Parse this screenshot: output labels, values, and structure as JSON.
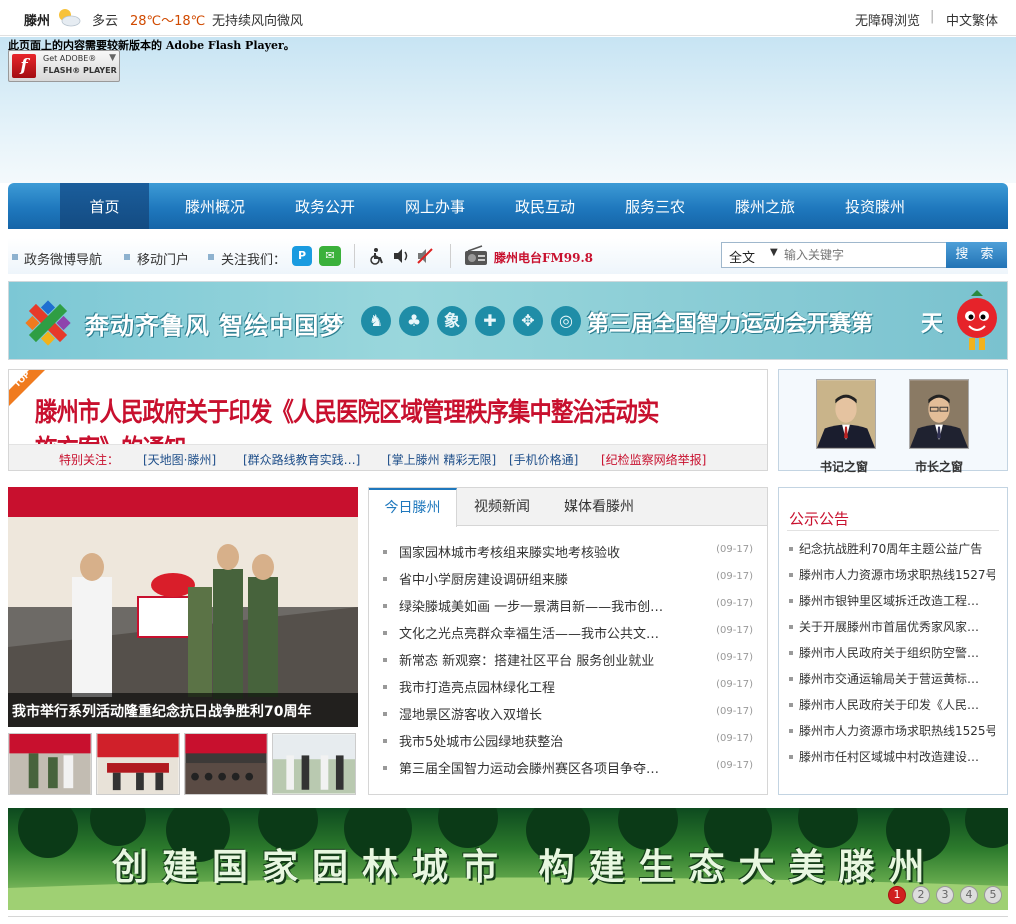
{
  "topbar": {
    "city": "滕州",
    "condition": "多云",
    "temperature": "28℃～18℃",
    "wind": "无持续风向微风",
    "accessibility": "无障碍浏览",
    "separator": "|",
    "traditional": "中文繁体"
  },
  "flash": {
    "message": "此页面上的内容需要较新版本的 Adobe Flash Player。",
    "button_line1": "Get ADOBE®",
    "button_line2": "FLASH® PLAYER"
  },
  "nav": {
    "items": [
      "首页",
      "滕州概况",
      "政务公开",
      "网上办事",
      "政民互动",
      "服务三农",
      "滕州之旅",
      "投资滕州"
    ]
  },
  "toolbar": {
    "weibo": "政务微博导航",
    "mobile": "移动门户",
    "follow": "关注我们：",
    "radio": "滕州电台FM99.8",
    "search_select": "全文",
    "search_placeholder": "输入关键字",
    "search_button": "搜 索"
  },
  "games_banner": {
    "slogan": "奔动齐鲁风 智绘中国梦",
    "icons": [
      "♞",
      "♣",
      "象",
      "✚",
      "✥",
      "◎"
    ],
    "title": "第三届全国智力运动会开赛第",
    "day": "天"
  },
  "headline": {
    "top_tag": "TOP",
    "title": "滕州市人民政府关于印发《人民医院区域管理秩序集中整治活动实施方案》的通知",
    "special_label": "特别关注：",
    "special_links": [
      "[天地图·滕州]",
      "[群众路线教育实践…]",
      "[掌上滕州 精彩无限]",
      "[手机价格通]",
      "[纪检监察网络举报]"
    ]
  },
  "leaders": {
    "secretary": "书记之窗",
    "mayor": "市长之窗"
  },
  "photo": {
    "caption": "我市举行系列活动隆重纪念抗日战争胜利70周年"
  },
  "news": {
    "tabs": [
      "今日滕州",
      "视频新闻",
      "媒体看滕州"
    ],
    "items": [
      {
        "title": "国家园林城市考核组来滕实地考核验收",
        "date": "(09-17)"
      },
      {
        "title": "省中小学厨房建设调研组来滕",
        "date": "(09-17)"
      },
      {
        "title": "绿染滕城美如画 一步一景满目新——我市创…",
        "date": "(09-17)"
      },
      {
        "title": "文化之光点亮群众幸福生活——我市公共文…",
        "date": "(09-17)"
      },
      {
        "title": "新常态 新观察：搭建社区平台 服务创业就业",
        "date": "(09-17)"
      },
      {
        "title": "我市打造亮点园林绿化工程",
        "date": "(09-17)"
      },
      {
        "title": "湿地景区游客收入双增长",
        "date": "(09-17)"
      },
      {
        "title": "我市5处城市公园绿地获整治",
        "date": "(09-17)"
      },
      {
        "title": "第三届全国智力运动会滕州赛区各项目争夺…",
        "date": "(09-17)"
      }
    ]
  },
  "notice": {
    "title": "公示公告",
    "items": [
      "纪念抗战胜利70周年主题公益广告",
      "滕州市人力资源市场求职热线1527号",
      "滕州市银钟里区域拆迁改造工程…",
      "关于开展滕州市首届优秀家风家…",
      "滕州市人民政府关于组织防空警…",
      "滕州市交通运输局关于营运黄标…",
      "滕州市人民政府关于印发《人民…",
      "滕州市人力资源市场求职热线1525号",
      "滕州市任村区域城中村改造建设…"
    ]
  },
  "forest_banner": {
    "slogan": "创建国家园林城市 构建生态大美滕州",
    "pages": [
      "1",
      "2",
      "3",
      "4",
      "5"
    ]
  },
  "colors": {
    "nav_blue": "#1f78bd",
    "headline_red": "#c8102e",
    "link_blue": "#1f4f8a"
  }
}
